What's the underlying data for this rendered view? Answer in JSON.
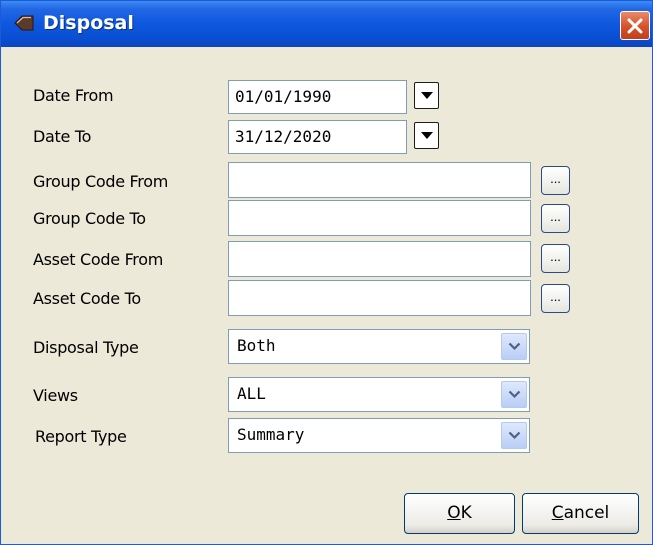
{
  "window": {
    "title": "Disposal",
    "icon": "tag-icon",
    "close_icon": "close-icon"
  },
  "fields": {
    "date_from": {
      "label": "Date From",
      "value": "01/01/1990"
    },
    "date_to": {
      "label": "Date To",
      "value": "31/12/2020"
    },
    "group_code_from": {
      "label": "Group Code From",
      "value": ""
    },
    "group_code_to": {
      "label": "Group Code To",
      "value": ""
    },
    "asset_code_from": {
      "label": "Asset Code From",
      "value": ""
    },
    "asset_code_to": {
      "label": "Asset Code To",
      "value": ""
    },
    "ellipsis_label": "...",
    "disposal_type": {
      "label": "Disposal Type",
      "value": "Both"
    },
    "views": {
      "label": "Views",
      "value": "ALL"
    },
    "report_type": {
      "label": "Report Type",
      "value": "Summary"
    }
  },
  "buttons": {
    "ok": {
      "mnemonic": "O",
      "rest": "K"
    },
    "cancel": {
      "mnemonic": "C",
      "rest": "ancel"
    }
  }
}
